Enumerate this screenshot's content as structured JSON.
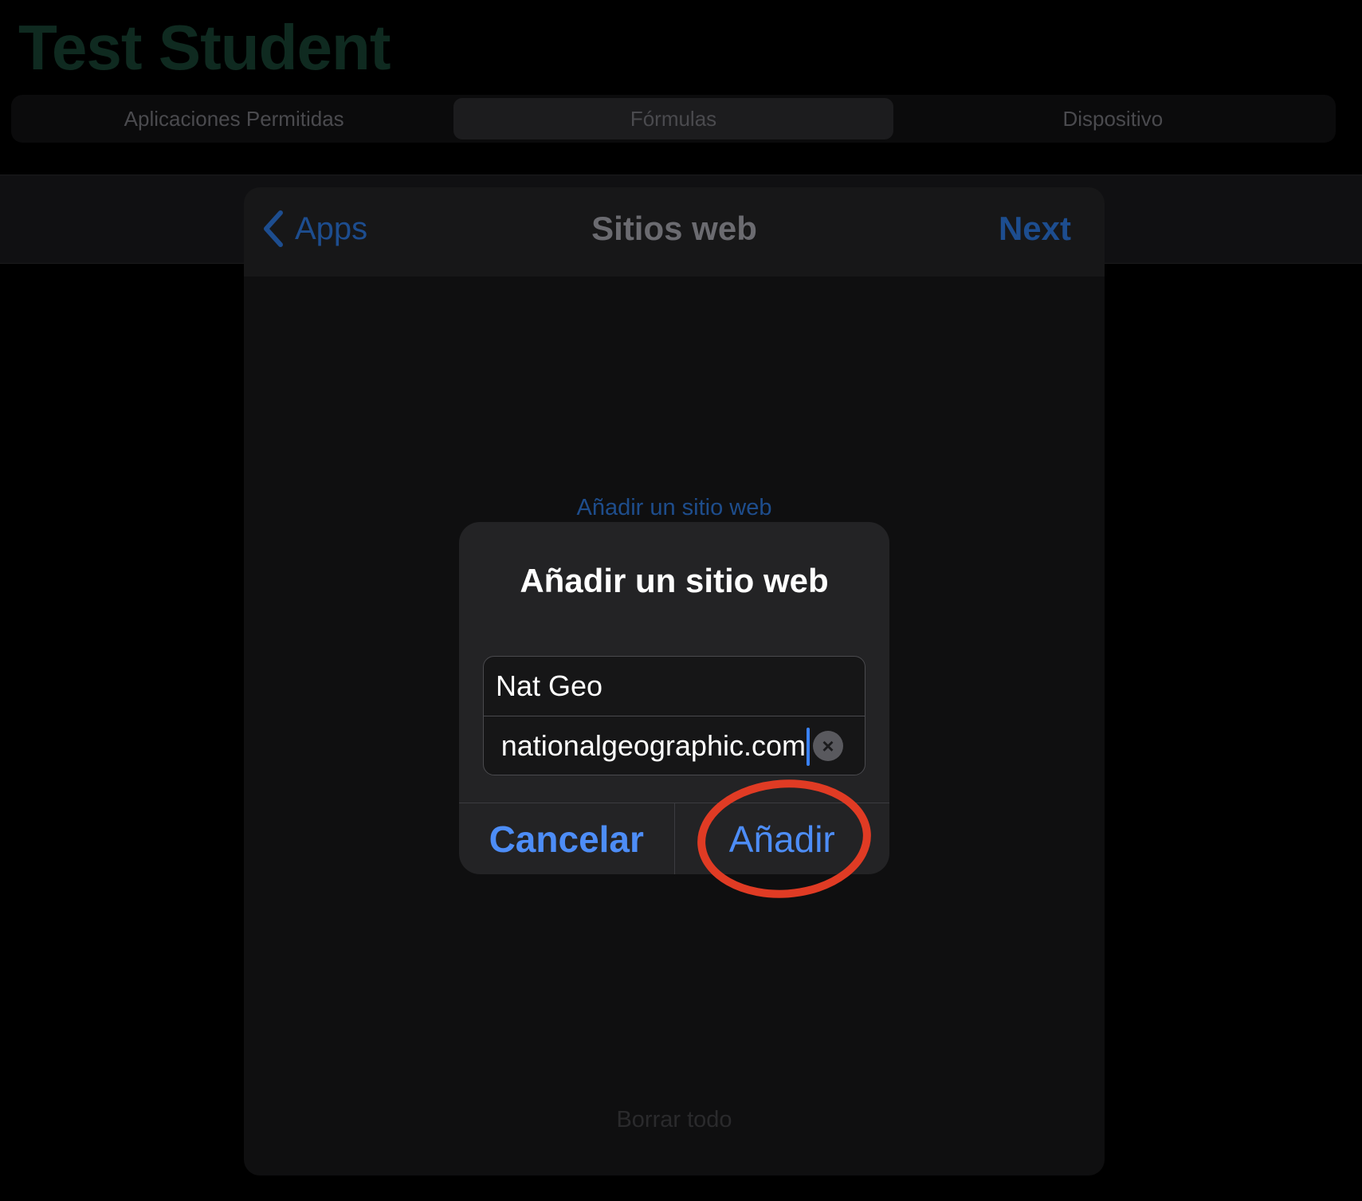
{
  "background": {
    "title": "Test Student",
    "tabs": [
      {
        "label": "Aplicaciones Permitidas",
        "selected": false
      },
      {
        "label": "Fórmulas",
        "selected": true
      },
      {
        "label": "Dispositivo",
        "selected": false
      }
    ]
  },
  "sheet": {
    "back_label": "Apps",
    "back_icon": "chevron-left-icon",
    "title": "Sitios web",
    "next_label": "Next",
    "add_link": "Añadir un sitio web",
    "clear_all": "Borrar todo"
  },
  "alert": {
    "title": "Añadir un sitio web",
    "name_value": "Nat Geo",
    "url_value": "nationalgeographic.com",
    "clear_icon": "clear-x-icon",
    "cancel_label": "Cancelar",
    "add_label": "Añadir"
  },
  "annotation": {
    "highlight_target": "Añadir",
    "highlight_color": "#e03b24"
  },
  "colors": {
    "accent_blue": "#4d8df7",
    "dim_blue": "#1d4d8f",
    "title_green_dimmed": "#0f2a20"
  }
}
